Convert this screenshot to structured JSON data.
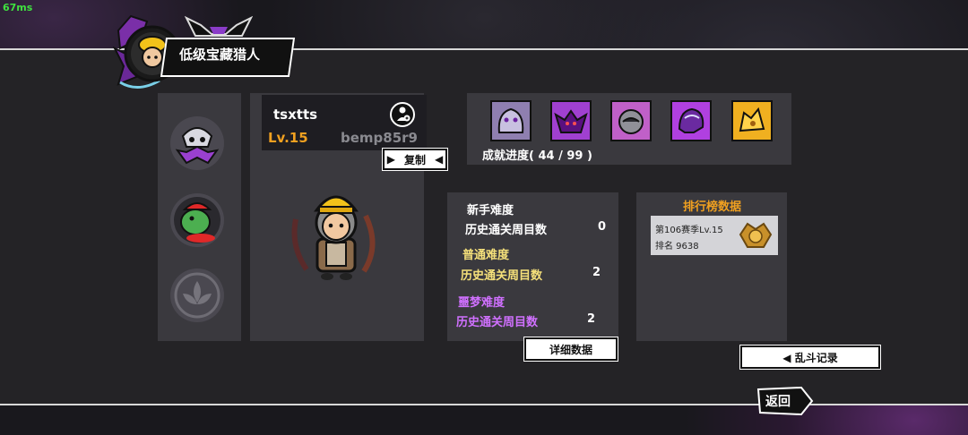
{
  "fps": "67ms",
  "title": "低级宝藏猎人",
  "player": {
    "name": "tsxtts",
    "level": "Lv.15",
    "id_code": "bemp85r9",
    "copy_label": "复制"
  },
  "achievements": {
    "progress_label": "成就进度( 44 / 99 )",
    "icons": [
      {
        "icon": "ghost-wolf-icon",
        "color": "#9a8ab0"
      },
      {
        "icon": "demon-bat-icon",
        "color": "#a040d0"
      },
      {
        "icon": "hooded-wraith-icon",
        "color": "#c060c8"
      },
      {
        "icon": "dragon-skull-icon",
        "color": "#b040e0"
      },
      {
        "icon": "golden-beast-icon",
        "color": "#f0b020"
      }
    ]
  },
  "difficulty": {
    "novice": {
      "title": "新手难度",
      "label": "历史通关周目数",
      "value": "0",
      "color": "#ffffff"
    },
    "normal": {
      "title": "普通难度",
      "label": "历史通关周目数",
      "value": "2",
      "color": "#f5e07a"
    },
    "nightmare": {
      "title": "噩梦难度",
      "label": "历史通关周目数",
      "value": "2",
      "color": "#d070ff"
    }
  },
  "detail_button": "详细数据",
  "leaderboard": {
    "title": "排行榜数据",
    "season": "第106赛季Lv.15",
    "rank": "排名 9638"
  },
  "brawl_button": "◀  乱斗记录",
  "back_button": "返回",
  "colors": {
    "accent_gold": "#f0a020",
    "panel": "#3a393e",
    "background": "#19181d"
  }
}
